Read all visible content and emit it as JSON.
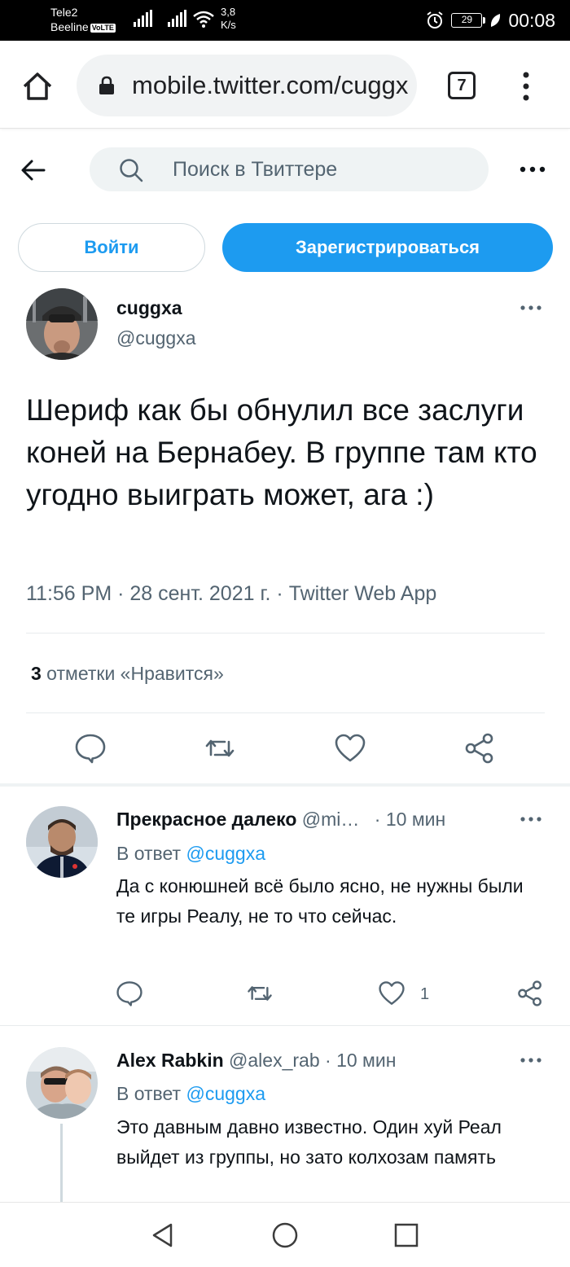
{
  "status_bar": {
    "carrier1": "Tele2",
    "carrier2": "Beeline",
    "volte": "VoLTE",
    "net_speed_value": "3,8",
    "net_speed_unit": "K/s",
    "battery": "29",
    "time": "00:08"
  },
  "browser": {
    "url": "mobile.twitter.com/cuggxa/status",
    "tab_count": "7"
  },
  "twitter_header": {
    "search_placeholder": "Поиск в Твиттере"
  },
  "auth": {
    "login_label": "Войти",
    "signup_label": "Зарегистрироваться"
  },
  "main_tweet": {
    "display_name": "cuggxa",
    "handle": "@cuggxa",
    "text": "Шериф как бы обнулил все заслуги коней на Бернабеу. В группе там кто угодно выиграть может, ага :)",
    "meta": "11:56 PM · 28 сент. 2021 г. · Twitter Web App",
    "likes_count": "3",
    "likes_label": " отметки «Нравится»"
  },
  "replies": [
    {
      "display_name": "Прекрасное далеко",
      "handle": "@mi…",
      "time": "· 10 мин",
      "reply_prefix": "В ответ ",
      "reply_mention": "@cuggxa",
      "text": "Да с конюшней всё было ясно, не нужны были те игры Реалу, не то что сейчас.",
      "like_count": "1"
    },
    {
      "display_name": "Alex Rabkin",
      "handle": "@alex_rab",
      "time": "· 10 мин",
      "reply_prefix": "В ответ ",
      "reply_mention": "@cuggxa",
      "text": "Это давным давно известно. Один хуй Реал выйдет из группы, но зато колхозам память"
    }
  ],
  "icons": {
    "home": "home-icon",
    "lock": "lock-icon",
    "back": "arrow-left-icon",
    "search": "search-icon",
    "more": "more-horizontal-icon",
    "reply": "speech-bubble-icon",
    "retweet": "retweet-icon",
    "like": "heart-icon",
    "share": "share-icon"
  },
  "colors": {
    "accent": "#1d9bf0",
    "text": "#0f1419",
    "secondary": "#536471"
  }
}
